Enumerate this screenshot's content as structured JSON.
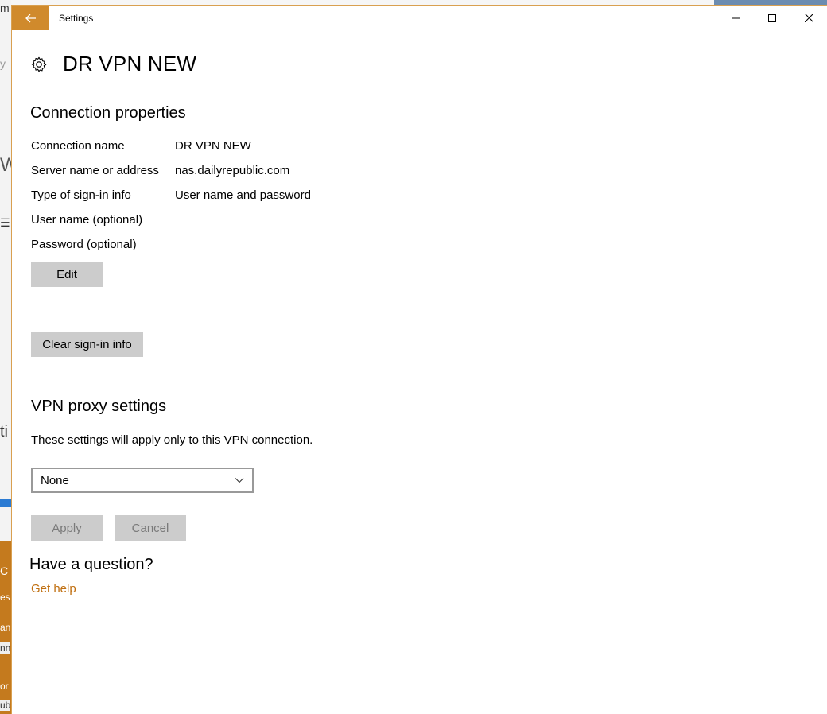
{
  "window": {
    "title": "Settings",
    "back_icon": "arrow-left-icon",
    "minimize_icon": "minimize-icon",
    "maximize_icon": "maximize-icon",
    "close_icon": "close-icon",
    "accent_color": "#d08a2c"
  },
  "page": {
    "icon": "gear-icon",
    "title": "DR VPN NEW"
  },
  "connection": {
    "heading": "Connection properties",
    "rows": [
      {
        "label": "Connection name",
        "value": "DR VPN NEW"
      },
      {
        "label": "Server name or address",
        "value": "nas.dailyrepublic.com"
      },
      {
        "label": "Type of sign-in info",
        "value": "User name and password"
      },
      {
        "label": "User name (optional)",
        "value": ""
      },
      {
        "label": "Password (optional)",
        "value": ""
      }
    ],
    "edit_label": "Edit",
    "clear_label": "Clear sign-in info"
  },
  "proxy": {
    "heading": "VPN proxy settings",
    "description": "These settings will apply only to this VPN connection.",
    "selected": "None",
    "apply_label": "Apply",
    "cancel_label": "Cancel"
  },
  "help": {
    "heading": "Have a question?",
    "link": "Get help",
    "link_color": "#c06f10"
  },
  "background": {
    "fragments": [
      "m",
      "y",
      "W",
      "☰",
      "ti",
      "C",
      "es",
      "an",
      "nn",
      "or",
      "ub"
    ]
  }
}
